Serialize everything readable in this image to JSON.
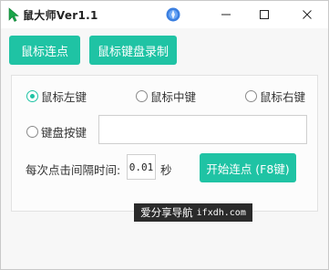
{
  "window": {
    "title": "鼠大师Ver1.1"
  },
  "toolbar": {
    "mouse_click_label": "鼠标连点",
    "keyboard_record_label": "鼠标键盘录制"
  },
  "options": {
    "left_key": "鼠标左键",
    "middle_key": "鼠标中键",
    "right_key": "鼠标右键",
    "keyboard_key": "键盘按键",
    "selected": "鼠标左键"
  },
  "key_input": {
    "value": ""
  },
  "interval": {
    "label": "每次点击间隔时间:",
    "value": "0.01",
    "unit": "秒"
  },
  "start_button": {
    "label": "开始连点 (F8键)"
  },
  "watermark": {
    "text": "爱分享导航",
    "url": "ifxdh.com"
  },
  "colors": {
    "accent": "#1fc3a4"
  }
}
